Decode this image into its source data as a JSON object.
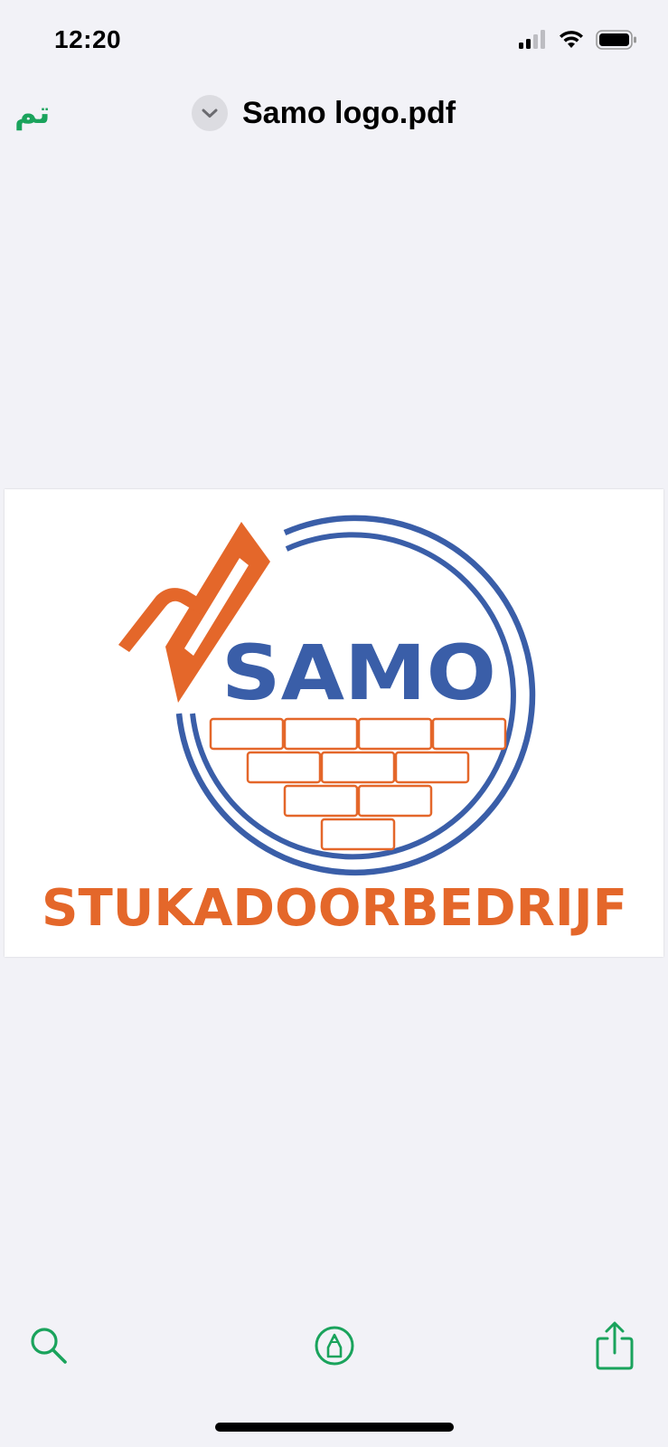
{
  "status_bar": {
    "time": "12:20"
  },
  "nav": {
    "done_label": "تم",
    "title": "Samo logo.pdf"
  },
  "logo": {
    "brand_name": "SAMO",
    "tagline": "STUKADOORBEDRIJF",
    "colors": {
      "blue": "#3a5ea8",
      "orange": "#e4672a"
    }
  },
  "toolbar": {
    "items": [
      "search-icon",
      "markup-icon",
      "share-icon"
    ],
    "accent_color": "#1aa35c"
  }
}
